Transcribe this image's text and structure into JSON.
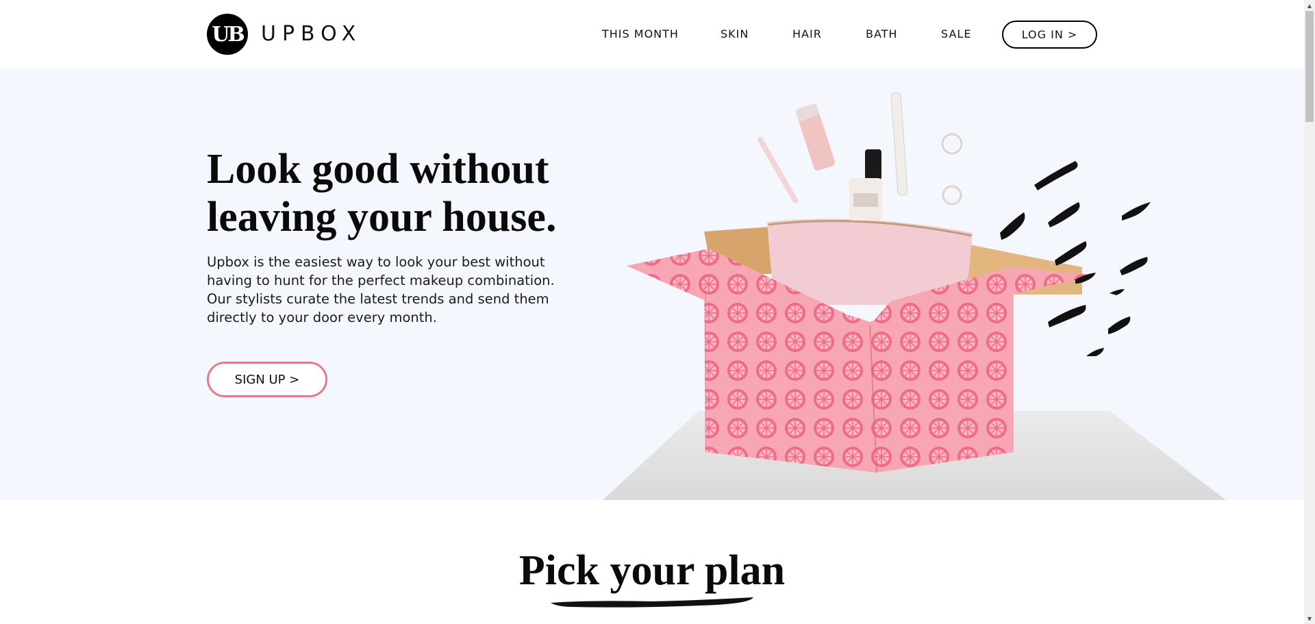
{
  "header": {
    "logo_mark": "UB",
    "logo_text": "UPBOX",
    "nav": [
      "THIS MONTH",
      "SKIN",
      "HAIR",
      "BATH",
      "SALE"
    ],
    "login_label": "LOG IN >"
  },
  "hero": {
    "title": "Look good without leaving your house.",
    "description": "Upbox is the easiest way to look your best without having to hunt for the perfect makeup combination. Our stylists curate the latest trends and send them directly to your door every month.",
    "signup_label": "SIGN UP >",
    "image_alt": "pink-patterned-box-with-beauty-products-icon"
  },
  "plans": {
    "title": "Pick your plan"
  },
  "colors": {
    "hero_bg": "#f4f7fd",
    "accent_pink": "#e8778e",
    "text": "#111111"
  },
  "scrollbar": {
    "up_arrow": "▲",
    "down_arrow": "▼"
  }
}
